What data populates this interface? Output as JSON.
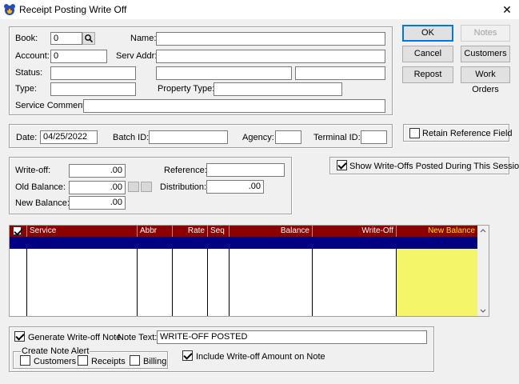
{
  "window": {
    "title": "Receipt Posting Write Off",
    "close_glyph": "✕"
  },
  "account_info": {
    "book_label": "Book:",
    "book_value": "0",
    "name_label": "Name:",
    "name_value": "",
    "account_label": "Account:",
    "account_value": "0",
    "serv_addr_label": "Serv Addr:",
    "serv_addr_value": "",
    "status_label": "Status:",
    "status_value": "",
    "type_label": "Type:",
    "type_value": "",
    "property_type_label": "Property Type:",
    "property_type_value": "",
    "service_comment_label": "Service Comment:",
    "service_comment_value": ""
  },
  "buttons": {
    "ok": "OK",
    "notes": "Notes",
    "cancel": "Cancel",
    "customers": "Customers",
    "repost": "Repost",
    "work_orders": "Work Orders"
  },
  "batch": {
    "date_label": "Date:",
    "date_value": "04/25/2022",
    "batch_id_label": "Batch ID:",
    "batch_id_value": "",
    "agency_label": "Agency:",
    "agency_value": "",
    "terminal_id_label": "Terminal ID:",
    "terminal_id_value": ""
  },
  "retain_reference": {
    "label": "Retain Reference Field",
    "checked": false
  },
  "show_writeoffs": {
    "label": "Show Write-Offs Posted During This Session",
    "checked": true
  },
  "writeoff": {
    "writeoff_label": "Write-off:",
    "writeoff_value": ".00",
    "reference_label": "Reference:",
    "reference_value": "",
    "old_balance_label": "Old Balance:",
    "old_balance_value": ".00",
    "distribution_label": "Distribution:",
    "distribution_value": ".00",
    "new_balance_label": "New Balance:",
    "new_balance_value": ".00"
  },
  "grid": {
    "columns": [
      "Service",
      "Abbr",
      "Rate",
      "Seq",
      "Balance",
      "Write-Off",
      "New Balance"
    ]
  },
  "note": {
    "generate_label": "Generate Write-off Note",
    "generate_checked": true,
    "note_text_label": "Note Text:",
    "note_text_value": "WRITE-OFF POSTED",
    "create_alert_label": "Create Note Alert",
    "alert_customers": "Customers",
    "alert_receipts": "Receipts",
    "alert_billing": "Billing",
    "include_amount_label": "Include Write-off Amount on Note",
    "include_amount_checked": true
  }
}
